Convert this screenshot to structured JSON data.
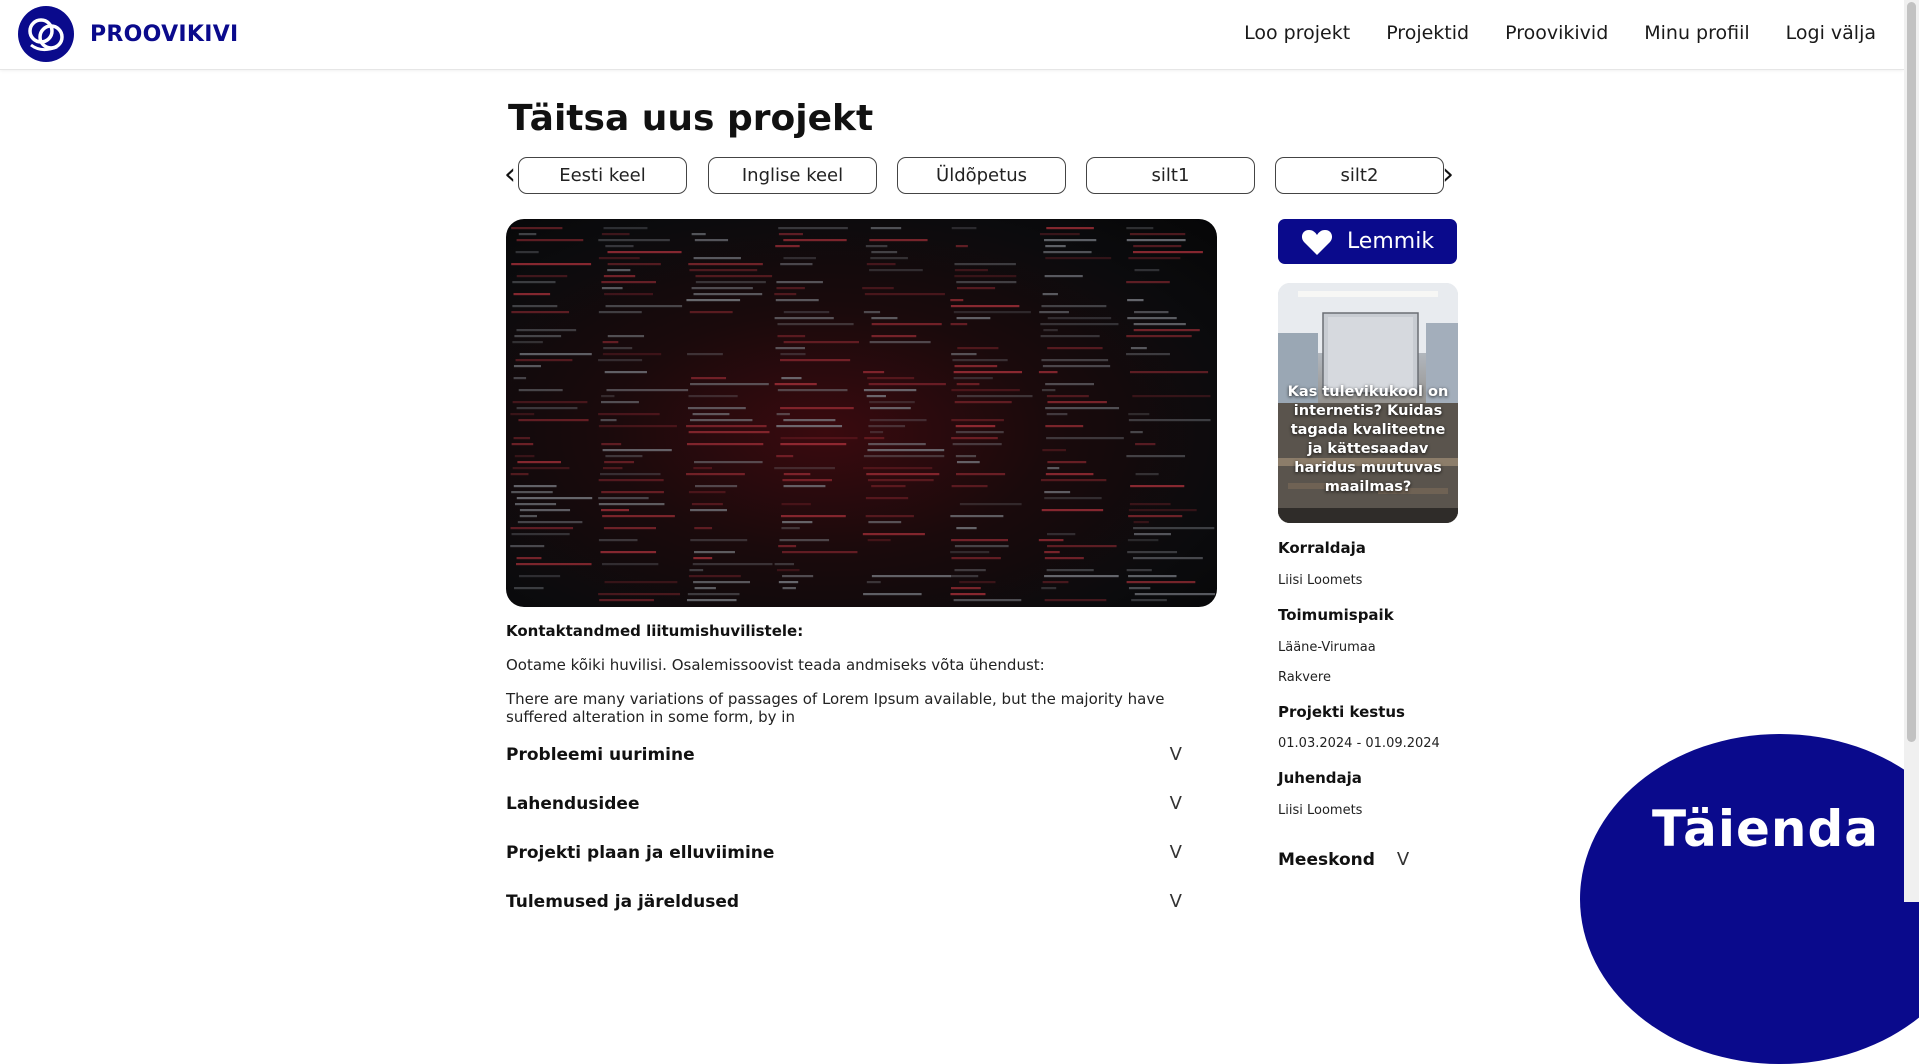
{
  "header": {
    "brand": "PROOVIKIVI",
    "nav": [
      "Loo projekt",
      "Projektid",
      "Proovikivid",
      "Minu profiil",
      "Logi välja"
    ]
  },
  "project": {
    "title": "Täitsa uus projekt",
    "tags": [
      "Eesti keel",
      "Inglise keel",
      "Üldõpetus",
      "silt1",
      "silt2"
    ],
    "contact_heading": "Kontaktandmed liitumishuvilistele:",
    "paragraphs": [
      "Ootame kõiki huvilisi. Osalemissoovist teada andmiseks võta ühendust:",
      "There are many variations of passages of Lorem Ipsum available, but the majority have suffered alteration in some form, by in"
    ],
    "sections": [
      "Probleemi uurimine",
      "Lahendusidee",
      "Projekti plaan ja elluviimine",
      "Tulemused ja järeldused"
    ]
  },
  "sidebar": {
    "favorite_label": "Lemmik",
    "promo_text": "Kas tulevikukool on internetis? Kuidas tagada kvaliteetne ja kättesaadav haridus muutuvas maailmas?",
    "organizer_label": "Korraldaja",
    "organizer": "Liisi Loomets",
    "location_label": "Toimumispaik",
    "location_county": "Lääne-Virumaa",
    "location_city": "Rakvere",
    "duration_label": "Projekti kestus",
    "duration": "01.03.2024 - 01.09.2024",
    "supervisor_label": "Juhendaja",
    "supervisor": "Liisi Loomets",
    "team_label": "Meeskond"
  },
  "chevron": "V",
  "arrows": {
    "left": "‹",
    "right": "›"
  },
  "cta": "Täienda",
  "colors": {
    "brand": "#0a0a8c",
    "text": "#111111",
    "background": "#ffffff"
  },
  "icons": {
    "favorite": "heart-icon",
    "logo": "proovikivi-logo-icon"
  }
}
